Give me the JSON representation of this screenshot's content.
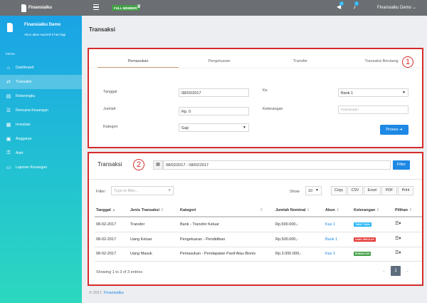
{
  "topbar": {
    "logo_text": "Finansialku",
    "member_badge": "FULL MEMBER",
    "speaker_badge": "3",
    "bell_badge": "1",
    "user_name": "Finansialku Demo"
  },
  "sidebar": {
    "user_name": "Finansialku Demo",
    "expiry": "Akun akan expired 9 hari lagi",
    "menu_title": "MENU",
    "items": [
      {
        "label": "Dashboard",
        "icon": "home-icon"
      },
      {
        "label": "Transaksi",
        "icon": "exchange-icon"
      },
      {
        "label": "Rekeningku",
        "icon": "wallet-icon"
      },
      {
        "label": "Rencana Keuangan",
        "icon": "list-icon"
      },
      {
        "label": "Investasi",
        "icon": "chart-icon"
      },
      {
        "label": "Anggaran",
        "icon": "clipboard-icon"
      },
      {
        "label": "Aset",
        "icon": "key-icon"
      },
      {
        "label": "Laporan Keuangan",
        "icon": "folder-icon"
      }
    ],
    "active_index": 1
  },
  "page": {
    "title": "Transaksi"
  },
  "form": {
    "tabs": [
      "Pemasukan",
      "Pengeluaran",
      "Transfer",
      "Transaksi Berulang"
    ],
    "active_tab": 0,
    "tanggal_label": "Tanggal",
    "tanggal_value": "08/02/2017",
    "jumlah_label": "Jumlah",
    "jumlah_value": "Rp. 0",
    "kategori_label": "Kategori",
    "kategori_value": "Gaji",
    "ke_label": "Ke",
    "ke_value": "Bank 1",
    "keterangan_label": "Keterangan",
    "keterangan_placeholder": "Keterangan",
    "proses_label": "Proses"
  },
  "annotations": {
    "one": "1",
    "two": "2"
  },
  "table_section": {
    "title": "Transaksi",
    "daterange": "08/02/2017 - 08/02/2017",
    "filter_button": "Filter",
    "filter_label": "Filter:",
    "filter_placeholder": "Type to filter...",
    "show_label": "Show",
    "show_value": "10",
    "export_buttons": [
      "Copy",
      "CSV",
      "Excel",
      "PDF",
      "Print"
    ],
    "columns": [
      "Tanggal",
      "Jenis Transaksi",
      "Kategori",
      "Jumlah Nominal",
      "Akun",
      "Keterangan",
      "Pilihan"
    ],
    "rows": [
      {
        "tanggal": "08-02-2017",
        "jenis": "Transfer",
        "kategori": "Bank - Transfer Keluar",
        "jumlah": "Rp.500.000,-",
        "akun": "Kas 1",
        "keterangan": "TARIK TUNAI",
        "tag_color": "#29b6f6"
      },
      {
        "tanggal": "08-02-2017",
        "jenis": "Uang Keluar",
        "kategori": "Pengeluaran - Pendidikan",
        "jumlah": "Rp.500.000,-",
        "akun": "Bank 1",
        "keterangan": "UANG SEKOLAH",
        "tag_color": "#e53935"
      },
      {
        "tanggal": "08-02-2017",
        "jenis": "Uang Masuk",
        "kategori": "Pemasukan - Pendapatan Pasif Atau Bisnis",
        "jumlah": "Rp.3.000.000,-",
        "akun": "Kas 1",
        "keterangan": "RUMAH KOS",
        "tag_color": "#43a047"
      }
    ],
    "showing": "Showing 1 to 3 of 3 entries",
    "prev": "←",
    "page": "1",
    "next": "→"
  },
  "footer": {
    "copyright": "© 2017.",
    "brand": "Finansialku"
  }
}
